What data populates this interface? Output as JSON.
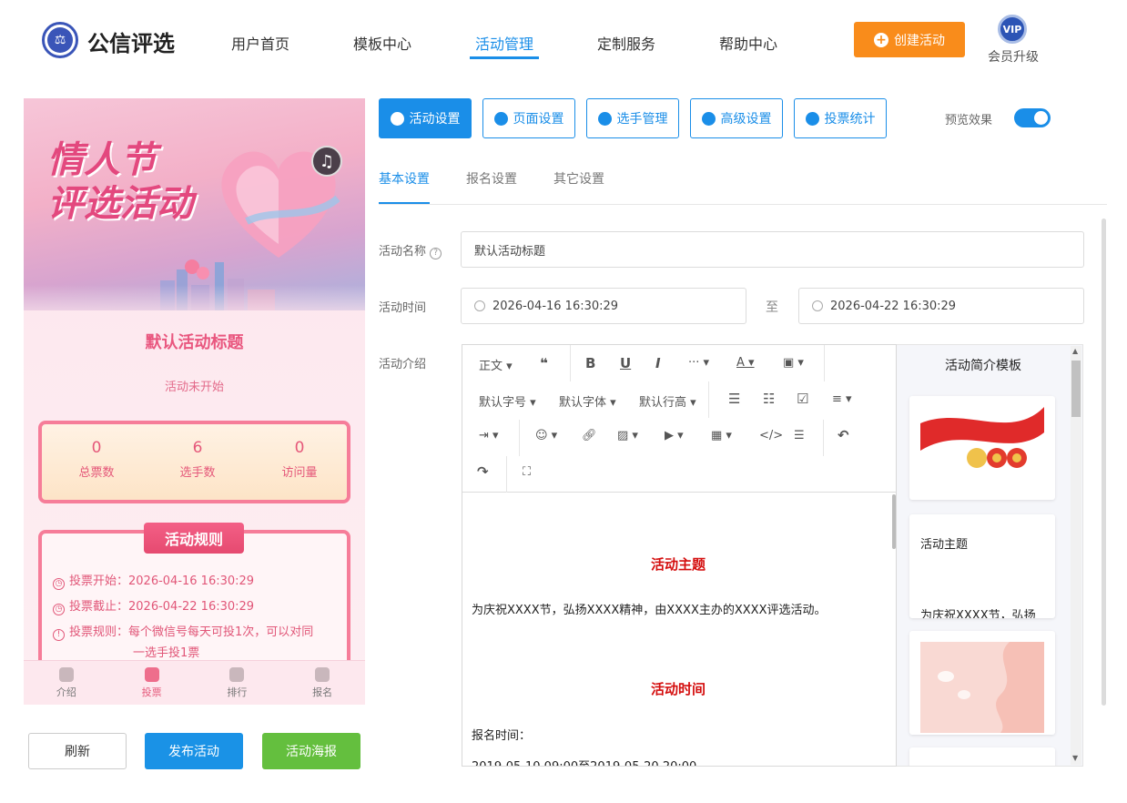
{
  "header": {
    "brand": "公信评选",
    "nav": [
      "用户首页",
      "模板中心",
      "活动管理",
      "定制服务",
      "帮助中心"
    ],
    "active_nav": "活动管理",
    "create_button": "创建活动",
    "vip_badge": "VIP",
    "vip_label": "会员升级"
  },
  "preview": {
    "banner_title_line1": "情人节",
    "banner_title_line2": "评选活动",
    "activity_title": "默认活动标题",
    "status": "活动未开始",
    "stats": [
      {
        "value": "0",
        "label": "总票数"
      },
      {
        "value": "6",
        "label": "选手数"
      },
      {
        "value": "0",
        "label": "访问量"
      }
    ],
    "rules_heading": "活动规则",
    "rules": {
      "start": "投票开始：2026-04-16 16:30:29",
      "end": "投票截止：2026-04-22 16:30:29",
      "rule_line1": "投票规则：每个微信号每天可投1次，可以对同",
      "rule_line2": "一选手投1票"
    },
    "tabs": [
      "介绍",
      "投票",
      "排行",
      "报名"
    ],
    "active_tab": "投票"
  },
  "actions": {
    "refresh": "刷新",
    "publish": "发布活动",
    "poster": "活动海报"
  },
  "settings_tabs": [
    "活动设置",
    "页面设置",
    "选手管理",
    "高级设置",
    "投票统计"
  ],
  "preview_toggle_label": "预览效果",
  "sub_tabs": [
    "基本设置",
    "报名设置",
    "其它设置"
  ],
  "form": {
    "name_label": "活动名称",
    "name_value": "默认活动标题",
    "time_label": "活动时间",
    "start_time": "2026-04-16 16:30:29",
    "to_label": "至",
    "end_time": "2026-04-22 16:30:29",
    "intro_label": "活动介绍"
  },
  "editor": {
    "toolbar": {
      "paragraph": "正文",
      "font_size": "默认字号",
      "font_family": "默认字体",
      "line_height": "默认行高"
    },
    "content": {
      "heading1": "活动主题",
      "para1": "为庆祝XXXX节，弘扬XXXX精神，由XXXX主办的XXXX评选活动。",
      "heading2": "活动时间",
      "para2": "报名时间：",
      "para3": "2019-05-10 09:00至2019-05-20 20:00"
    }
  },
  "templates": {
    "title": "活动简介模板",
    "card2_title": "活动主题",
    "card2_text": "为庆祝XXXX节，弘扬"
  },
  "colors": {
    "primary": "#1a8ee8",
    "orange": "#f98c1b",
    "green": "#64bf3e",
    "pink": "#e5587a",
    "red_heading": "#d40d0d"
  }
}
